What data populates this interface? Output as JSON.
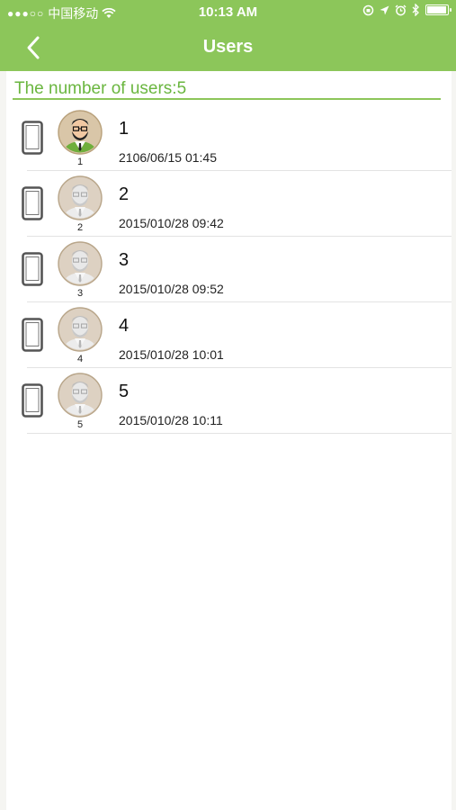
{
  "status_bar": {
    "signal": "●●●○○",
    "carrier": "中国移动",
    "wifi_icon": "wifi-icon",
    "time": "10:13 AM"
  },
  "nav": {
    "title": "Users",
    "back_icon": "chevron-left-icon"
  },
  "colors": {
    "header_green": "#8cc65a",
    "label_green": "#6ab63f"
  },
  "summary": {
    "label": "The number of users:5"
  },
  "users": [
    {
      "name": "1",
      "caption": "1",
      "time": "2106/06/15 01:45",
      "device_icon": "phone-icon",
      "avatar": "colored"
    },
    {
      "name": "2",
      "caption": "2",
      "time": "2015/010/28 09:42",
      "device_icon": "phone-icon",
      "avatar": "gray"
    },
    {
      "name": "3",
      "caption": "3",
      "time": "2015/010/28 09:52",
      "device_icon": "phone-icon",
      "avatar": "gray"
    },
    {
      "name": "4",
      "caption": "4",
      "time": "2015/010/28 10:01",
      "device_icon": "phone-icon",
      "avatar": "gray"
    },
    {
      "name": "5",
      "caption": "5",
      "time": "2015/010/28 10:11",
      "device_icon": "phone-icon",
      "avatar": "gray"
    }
  ]
}
